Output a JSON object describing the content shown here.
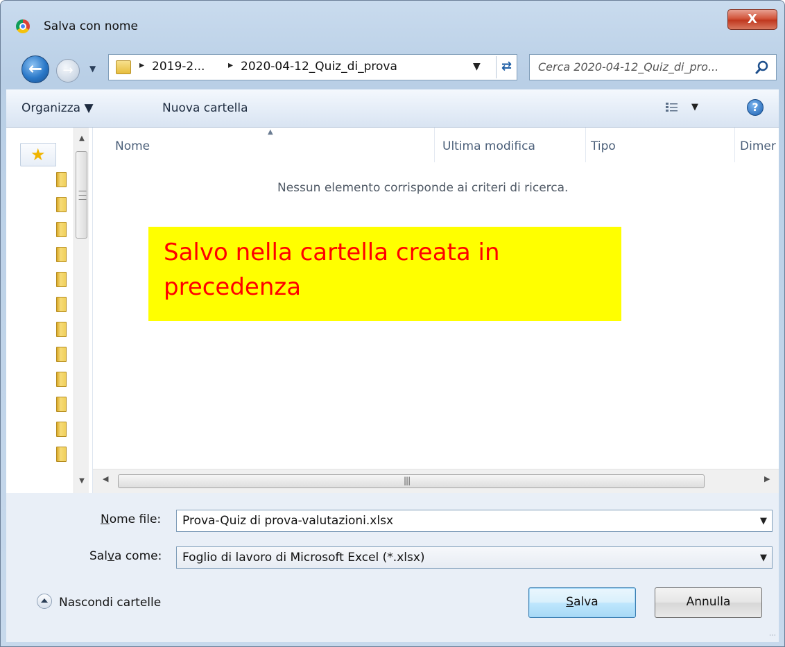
{
  "window": {
    "title": "Salva con nome",
    "close_label": "X"
  },
  "address": {
    "crumbs": [
      "2019-2...",
      "2020-04-12_Quiz_di_prova"
    ],
    "search_placeholder": "Cerca 2020-04-12_Quiz_di_pro..."
  },
  "toolbar": {
    "organize": "Organizza ▼",
    "new_folder": "Nuova cartella",
    "help": "?"
  },
  "columns": [
    "Nome",
    "Ultima modifica",
    "Tipo",
    "Dimer"
  ],
  "list": {
    "empty_message": "Nessun elemento corrisponde ai criteri di ricerca."
  },
  "annotation": {
    "text": "Salvo nella cartella creata in precedenza"
  },
  "form": {
    "filename_label_underlined": "N",
    "filename_label_rest": "ome file:",
    "filename_value": "Prova-Quiz di prova-valutazioni.xlsx",
    "savetype_label_a": "Sal",
    "savetype_label_underlined": "v",
    "savetype_label_b": "a come:",
    "savetype_value": "Foglio di lavoro di Microsoft Excel (*.xlsx)"
  },
  "footer": {
    "hide_folders": "Nascondi cartelle",
    "save_underlined": "S",
    "save_rest": "alva",
    "cancel": "Annulla"
  },
  "colors": {
    "annotation_bg": "#ffff00",
    "annotation_text": "#ff0000"
  }
}
